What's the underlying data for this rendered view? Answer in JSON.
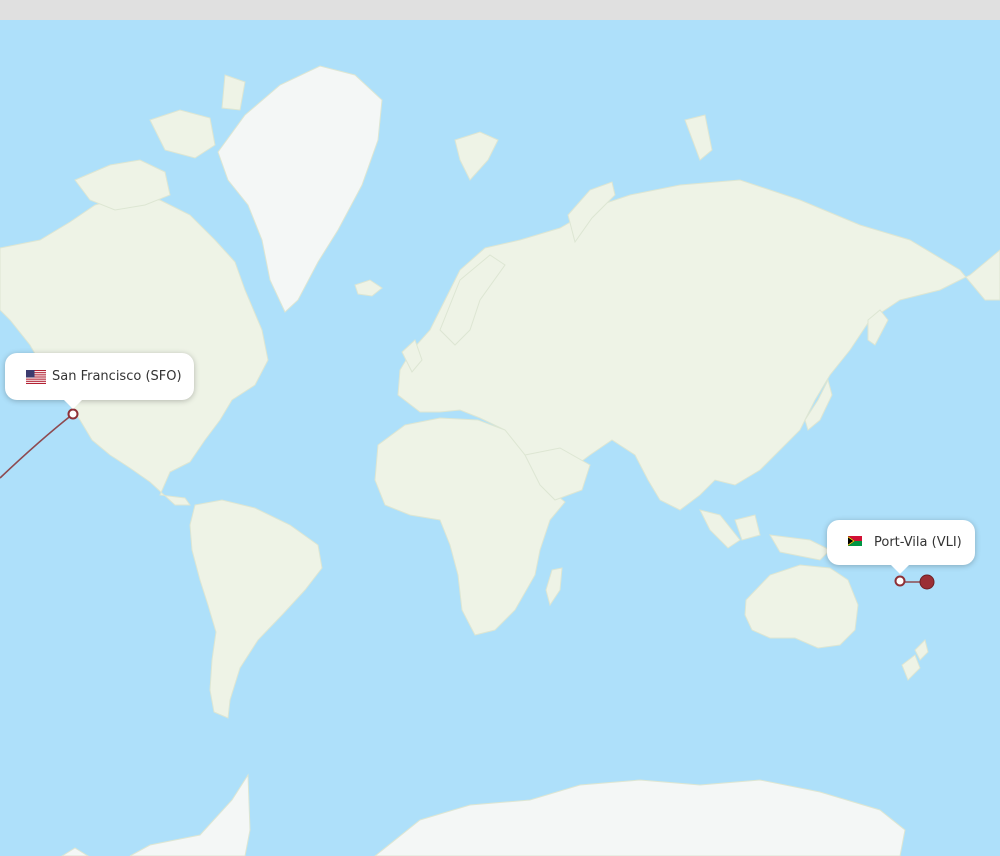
{
  "colors": {
    "ocean": "#aee0fa",
    "land": "#eef3e6",
    "ice": "#f4f7f6",
    "route": "#8e4a50",
    "marker": "#8e3036",
    "callout_bg": "#ffffff",
    "top_bar": "#e0e0e0"
  },
  "origin": {
    "city": "San Francisco",
    "code": "SFO",
    "label": "San Francisco (SFO)",
    "flag_icon": "us-flag-icon"
  },
  "destination": {
    "city": "Port-Vila",
    "code": "VLI",
    "label": "Port-Vila (VLI)",
    "flag_icon": "vanuatu-flag-icon"
  }
}
